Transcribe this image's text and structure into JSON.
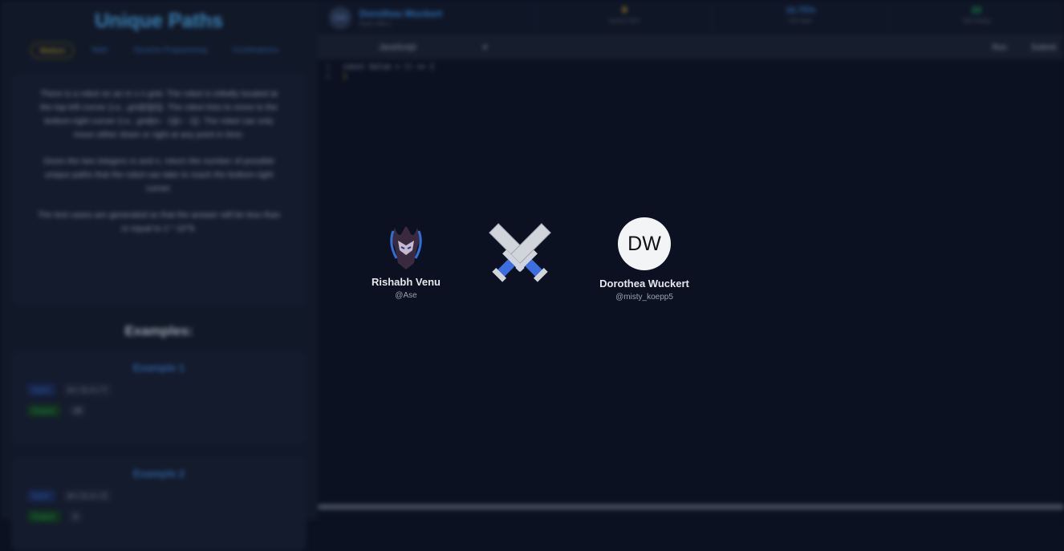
{
  "problem": {
    "title": "Unique Paths",
    "difficulty": "Medium",
    "tags": [
      "Math",
      "Dynamic Programming",
      "Combinatorics"
    ],
    "description": [
      "There is a robot on an m x n grid. The robot is initially located at the top-left corner (i.e., grid[0][0]). The robot tries to move to the bottom-right corner (i.e., grid[m - 1][n - 1]). The robot can only move either down or right at any point in time.",
      "Given the two integers m and n, return the number of possible unique paths that the robot can take to reach the bottom-right corner.",
      "The test cases are generated so that the answer will be less than or equal to 2 * 10^9."
    ],
    "examples_heading": "Examples:",
    "examples": [
      {
        "title": "Example 1",
        "input_label": "Input:",
        "input": "m = 3, n = 7",
        "output_label": "Output:",
        "output": "28"
      },
      {
        "title": "Example 2",
        "input_label": "Input:",
        "input": "m = 3, n = 2",
        "output_label": "Output:",
        "output": "3"
      }
    ]
  },
  "opponent": {
    "initials": "DW",
    "name": "Dorothea Wuckert",
    "rank": "Rank: #99+1",
    "stats": [
      {
        "value": "9",
        "label": "Games Won",
        "color": "#b4941a"
      },
      {
        "value": "16.75%",
        "label": "Win Rate",
        "color": "#2f5d9e"
      },
      {
        "value": "23",
        "label": "Skill Rating",
        "color": "#1f8f4a"
      }
    ]
  },
  "editor": {
    "language": "JavaScript",
    "run": "Run",
    "submit": "Submit",
    "lines": [
      "const Solve = () => {",
      "}"
    ]
  },
  "match": {
    "player1": {
      "name": "Rishabh Venu",
      "handle": "@Ase"
    },
    "player2": {
      "initials": "DW",
      "name": "Dorothea Wuckert",
      "handle": "@misty_koepp5"
    },
    "icon": "crossed-swords-icon"
  }
}
